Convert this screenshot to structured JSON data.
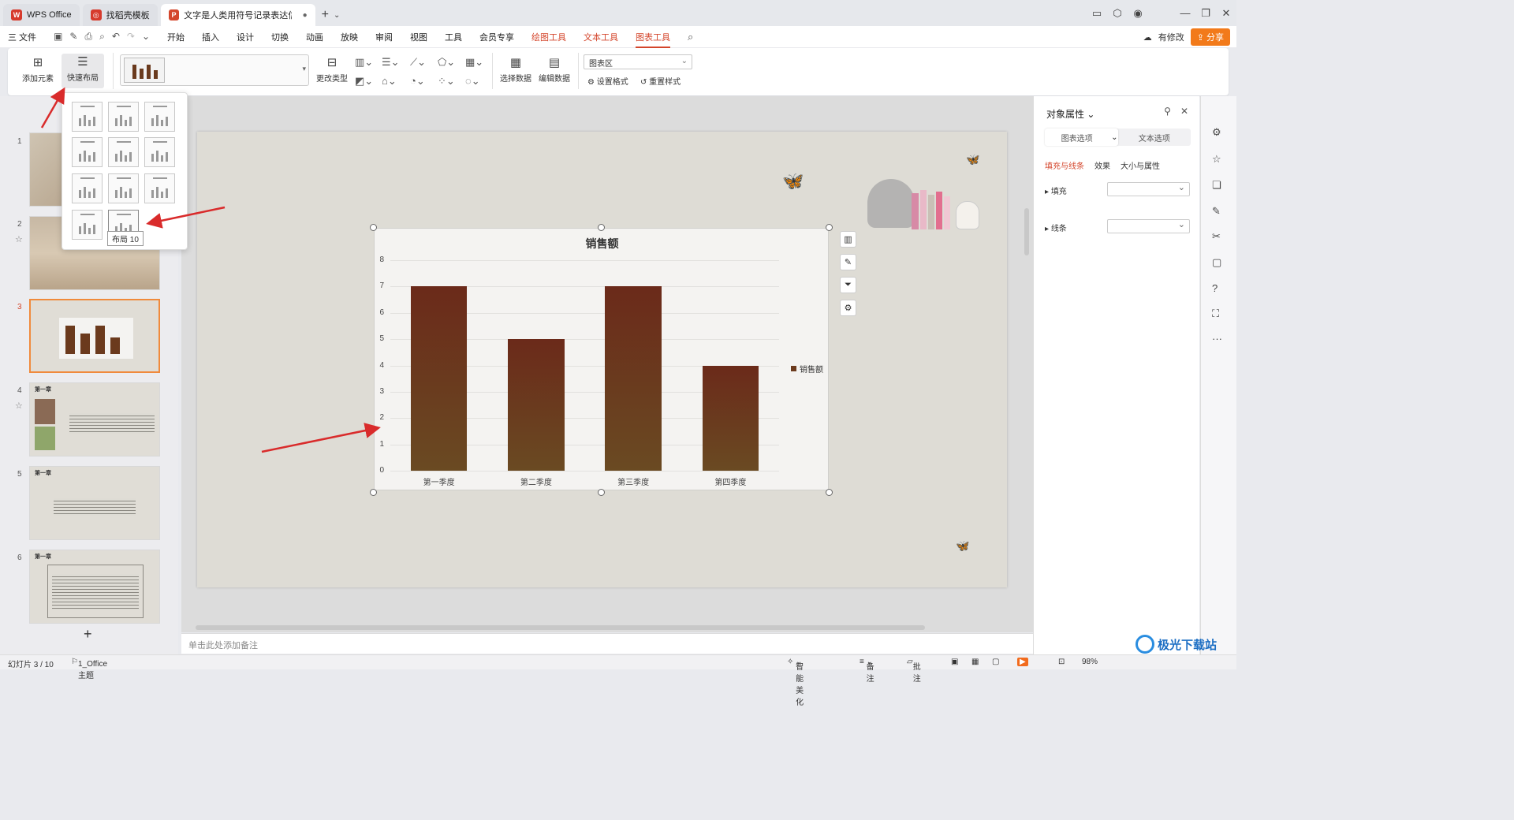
{
  "tabs": [
    {
      "label": "WPS Office",
      "logo": "W",
      "logo_color": "#d63a2c"
    },
    {
      "label": "找稻壳模板",
      "logo": "◎",
      "logo_color": "#d63a2c"
    },
    {
      "label": "文字是人类用符号记录表达信息以",
      "logo": "P",
      "logo_color": "#d4462c"
    }
  ],
  "menu": {
    "file": "三 文件",
    "items": [
      "开始",
      "插入",
      "设计",
      "切换",
      "动画",
      "放映",
      "审阅",
      "视图",
      "工具",
      "会员专享"
    ],
    "context_items": [
      "绘图工具",
      "文本工具",
      "图表工具"
    ],
    "modified": "有修改",
    "share": "分享"
  },
  "ribbon": {
    "add_element": "添加元素",
    "quick_layout": "快速布局",
    "change_type": "更改类型",
    "select_data": "选择数据",
    "edit_data": "编辑数据",
    "area_select": "图表区",
    "set_format": "设置格式",
    "reset_style": "重置样式"
  },
  "layout_tooltip": "布局 10",
  "slide_numbers": [
    "1",
    "2",
    "3",
    "4",
    "5",
    "6"
  ],
  "slide_thumb_text": {
    "chapter": "第一章"
  },
  "chart_data": {
    "type": "bar",
    "title": "销售额",
    "categories": [
      "第一季度",
      "第二季度",
      "第三季度",
      "第四季度"
    ],
    "series": [
      {
        "name": "销售额",
        "values": [
          7,
          5,
          7,
          4
        ]
      }
    ],
    "ylim": [
      0,
      8
    ],
    "yticks": [
      "0",
      "1",
      "2",
      "3",
      "4",
      "5",
      "6",
      "7",
      "8"
    ],
    "legend": "right",
    "bar_color": "#6b3a1d"
  },
  "notes_placeholder": "单击此处添加备注",
  "props": {
    "title": "对象属性",
    "seg_chart": "图表选项",
    "seg_text": "文本选项",
    "tab_fill": "填充与线条",
    "tab_effect": "效果",
    "tab_size": "大小与属性",
    "fill": "填充",
    "line": "线条"
  },
  "status": {
    "slide_info": "幻灯片 3 / 10",
    "theme": "1_Office 主题",
    "beautify": "智能美化",
    "notes": "备注",
    "comments": "批注",
    "zoom": "98%"
  },
  "watermark": "极光下载站"
}
